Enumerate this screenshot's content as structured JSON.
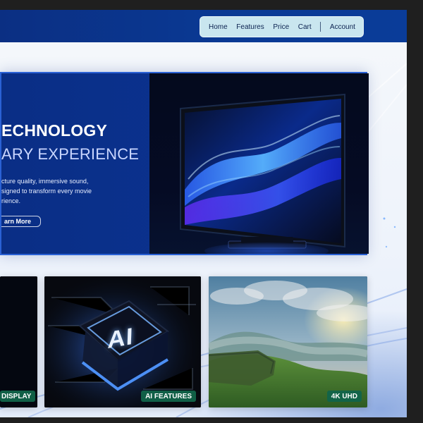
{
  "header": {
    "nav": [
      "Home",
      "Features",
      "Price",
      "Cart",
      "Account"
    ]
  },
  "hero": {
    "title_line1": "ECHNOLOGY",
    "title_line2": "ARY EXPERIENCE",
    "description": "cture quality, immersive sound,\nsigned to transform every movie\nrience.",
    "button": "arn More"
  },
  "cards": {
    "display_label": "DISPLAY",
    "ai_label": "AI FEATURES",
    "ai_chip_text": "AI",
    "uhd_label": "4K UHD"
  },
  "colors": {
    "header_blue": "#0b2f83",
    "nav_bg": "#c9e6ef",
    "hero_blue": "#0b3290",
    "hero_border": "#2a61d5",
    "label_green": "#11644a"
  },
  "icons": {
    "nav_divider": "vertical-bar"
  }
}
